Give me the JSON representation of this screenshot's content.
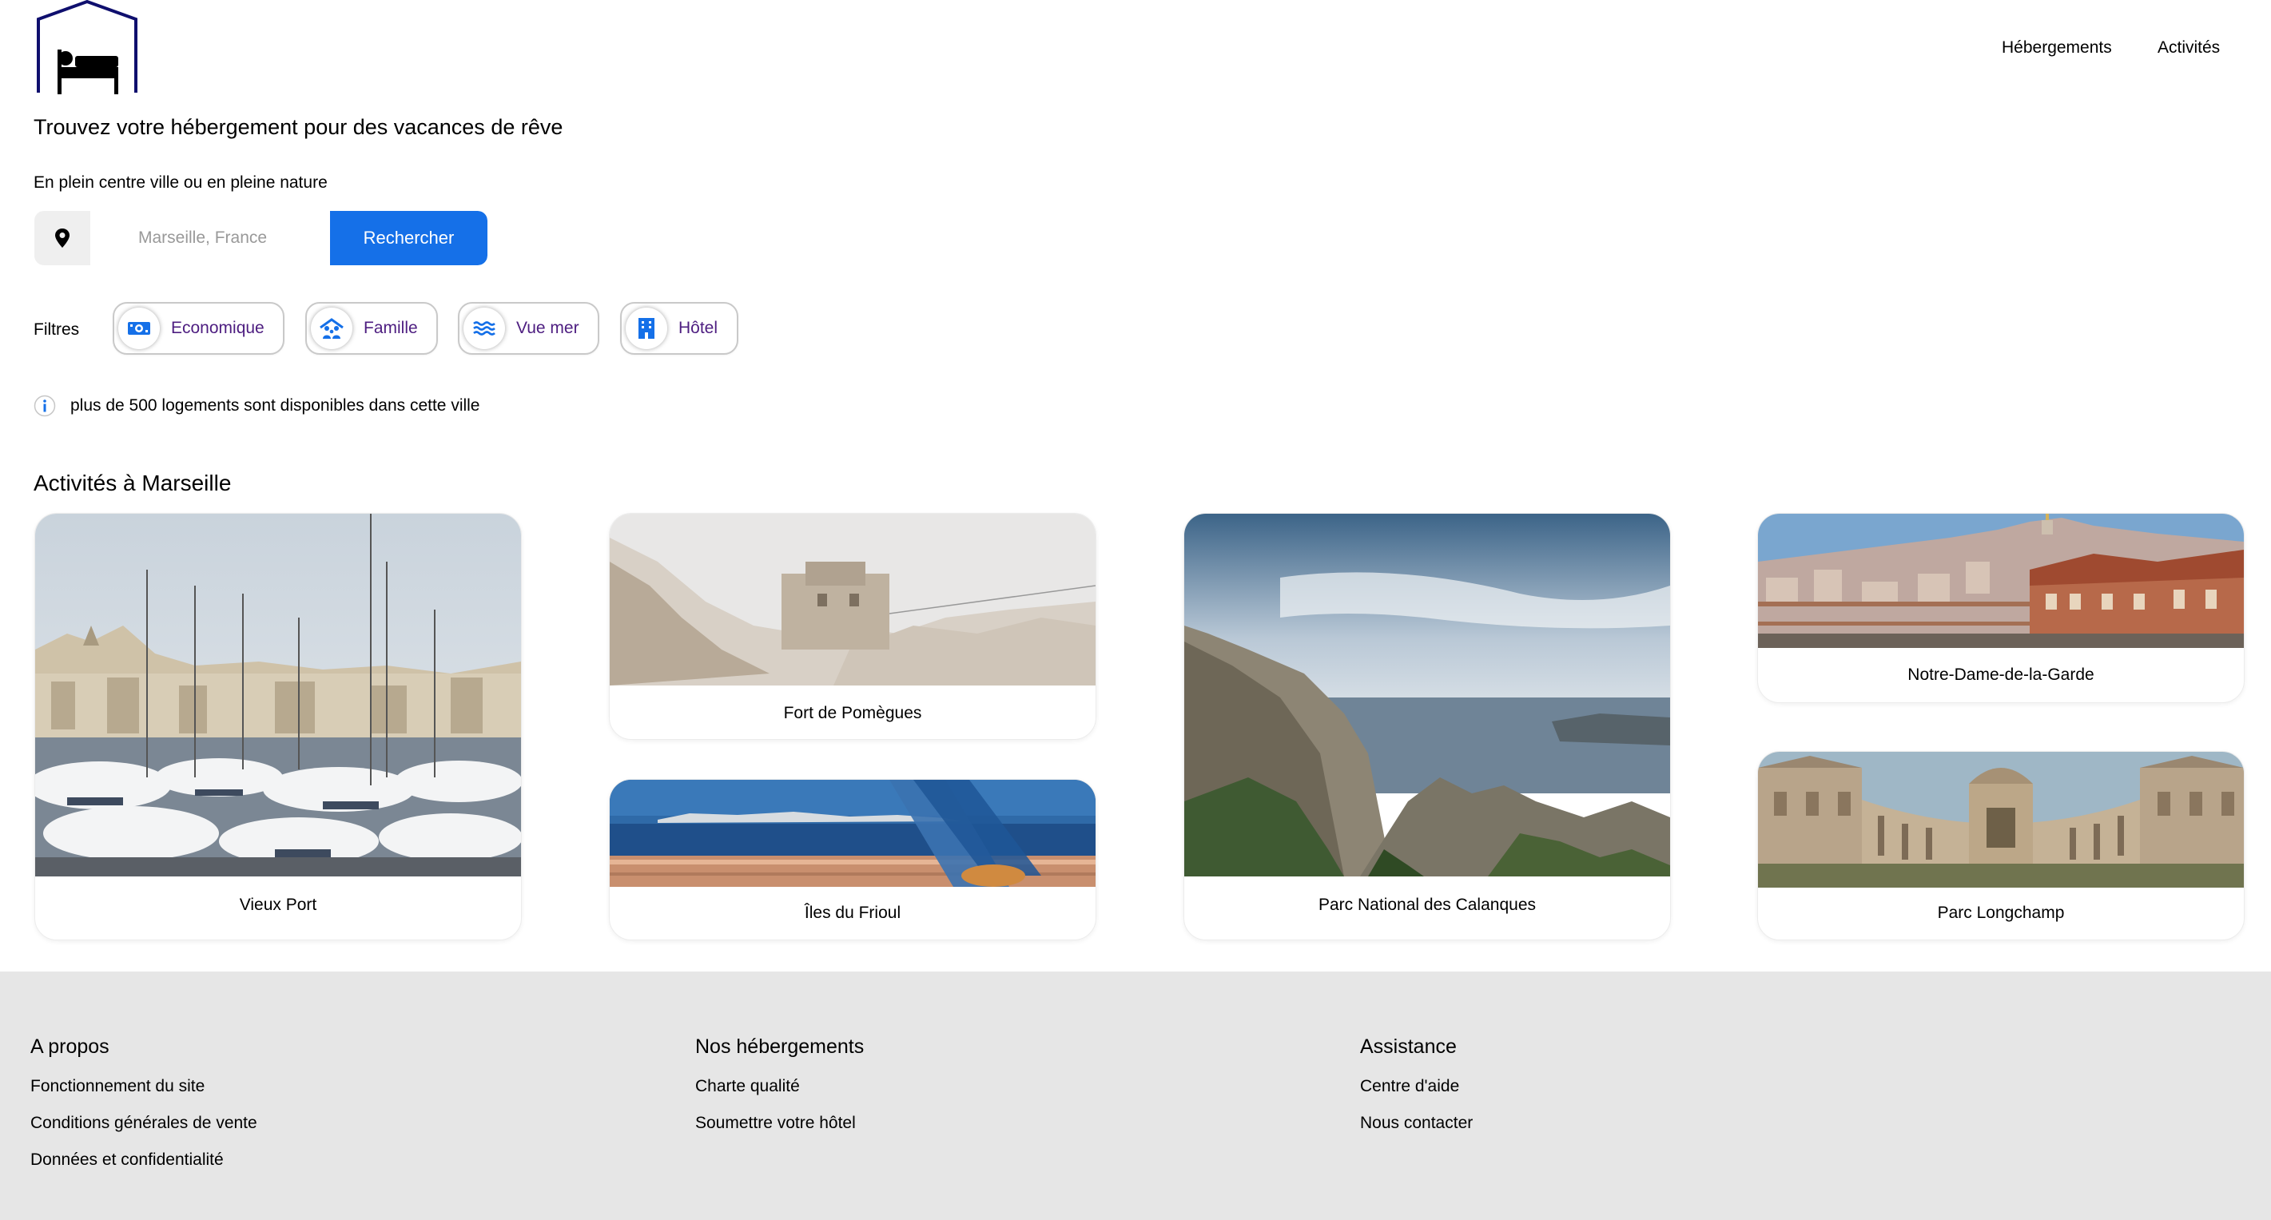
{
  "header": {
    "logo_icon": "bed-house-icon",
    "nav": [
      {
        "label": "Hébergements"
      },
      {
        "label": "Activités"
      }
    ]
  },
  "hero": {
    "title": "Trouvez votre hébergement pour des vacances de rêve",
    "subtitle": "En plein centre ville ou en pleine nature"
  },
  "search": {
    "icon": "map-pin-icon",
    "placeholder": "Marseille, France",
    "value": "",
    "button_label": "Rechercher",
    "button_color": "#1570e8"
  },
  "filters": {
    "label": "Filtres",
    "chips": [
      {
        "label": "Economique",
        "icon": "money-icon"
      },
      {
        "label": "Famille",
        "icon": "family-icon"
      },
      {
        "label": "Vue mer",
        "icon": "waves-icon"
      },
      {
        "label": "Hôtel",
        "icon": "hotel-icon"
      }
    ],
    "chip_text_color": "#4d1d80",
    "chip_icon_color": "#1570e8"
  },
  "info": {
    "icon": "info-icon",
    "text": "plus de 500 logements sont disponibles dans cette ville"
  },
  "activities": {
    "title": "Activités à Marseille",
    "cards": [
      {
        "label": "Vieux Port"
      },
      {
        "label": "Fort de Pomègues"
      },
      {
        "label": "Îles du Frioul"
      },
      {
        "label": "Parc National des Calanques"
      },
      {
        "label": "Notre-Dame-de-la-Garde"
      },
      {
        "label": "Parc Longchamp"
      }
    ]
  },
  "footer": {
    "columns": [
      {
        "title": "A propos",
        "links": [
          "Fonctionnement du site",
          "Conditions générales de vente",
          "Données et confidentialité"
        ]
      },
      {
        "title": "Nos hébergements",
        "links": [
          "Charte qualité",
          "Soumettre votre hôtel"
        ]
      },
      {
        "title": "Assistance",
        "links": [
          "Centre d'aide",
          "Nous contacter"
        ]
      }
    ]
  }
}
